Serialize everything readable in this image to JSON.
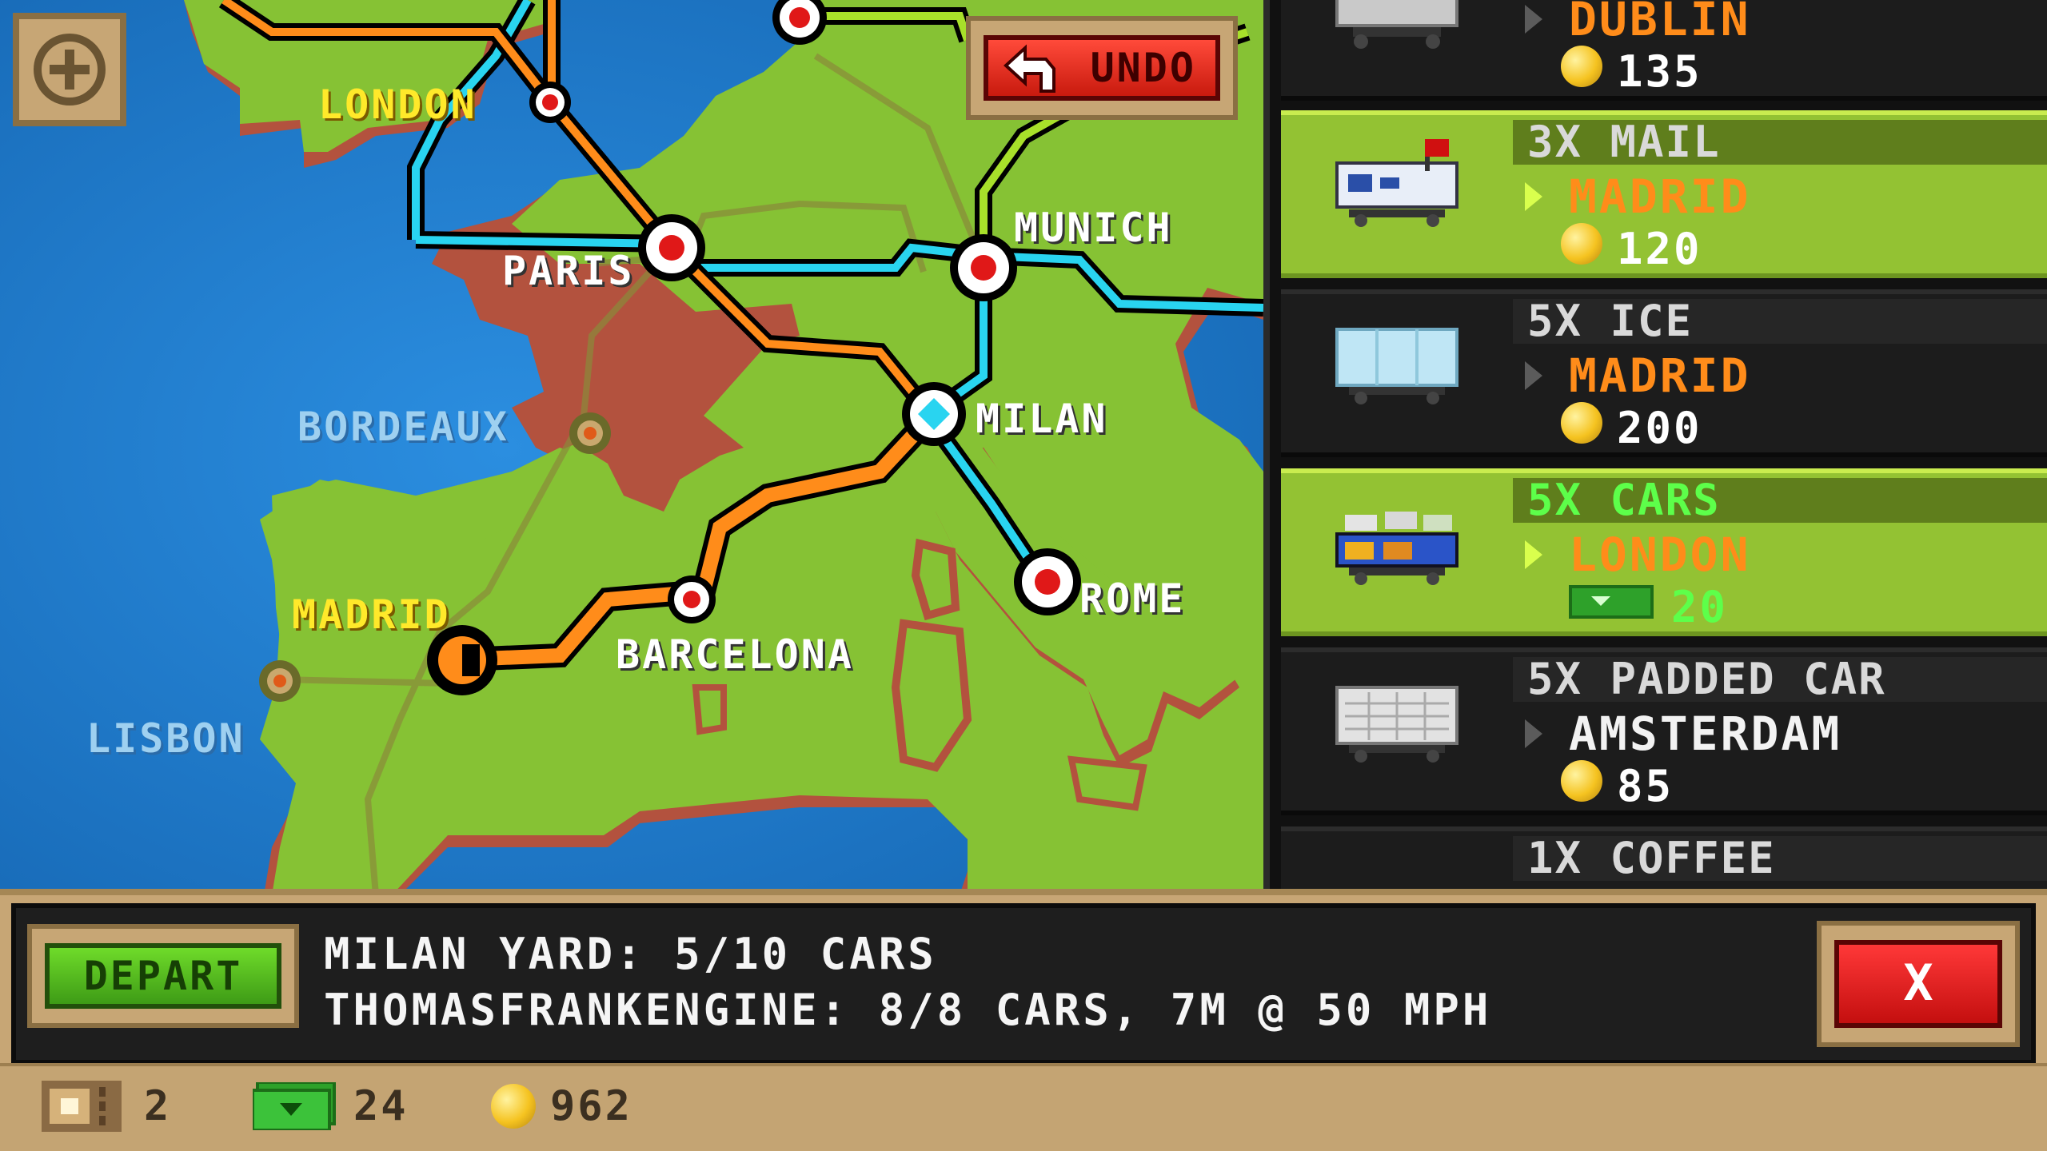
{
  "cities": {
    "london": "LONDON",
    "paris": "PARIS",
    "munich": "MUNICH",
    "milan": "MILAN",
    "bordeaux": "BORDEAUX",
    "madrid": "MADRID",
    "barcelona": "BARCELONA",
    "rome": "ROME",
    "lisbon": "LISBON"
  },
  "undo_label": "UNDO",
  "cargo": [
    {
      "qty": "",
      "dest": "DUBLIN",
      "pay": "135",
      "pay_icon": "coin-icon"
    },
    {
      "qty": "3X MAIL",
      "dest": "MADRID",
      "pay": "120",
      "pay_icon": "coin-icon"
    },
    {
      "qty": "5X ICE",
      "dest": "MADRID",
      "pay": "200",
      "pay_icon": "coin-icon"
    },
    {
      "qty": "5X CARS",
      "dest": "LONDON",
      "pay": "20",
      "pay_icon": "cash-icon"
    },
    {
      "qty": "5X PADDED CAR",
      "dest": "AMSTERDAM",
      "pay": "85",
      "pay_icon": "coin-icon"
    },
    {
      "qty": "1X COFFEE",
      "dest": "",
      "pay": "",
      "pay_icon": ""
    }
  ],
  "info": {
    "depart_label": "DEPART",
    "yard_line": "MILAN YARD: 5/10 CARS",
    "engine_line": "THOMASFRANKENGINE: 8/8 CARS, 7M @ 50 MPH",
    "close_label": "X"
  },
  "status": {
    "tickets": "2",
    "cash": "24",
    "coins": "962"
  },
  "colors": {
    "sea": "#1a78c8",
    "land": "#86c234",
    "route_orange": "#ff8c1a",
    "route_cyan": "#29d4f0",
    "route_lime": "#a8e02a",
    "city_yellow": "#ffe92a"
  }
}
